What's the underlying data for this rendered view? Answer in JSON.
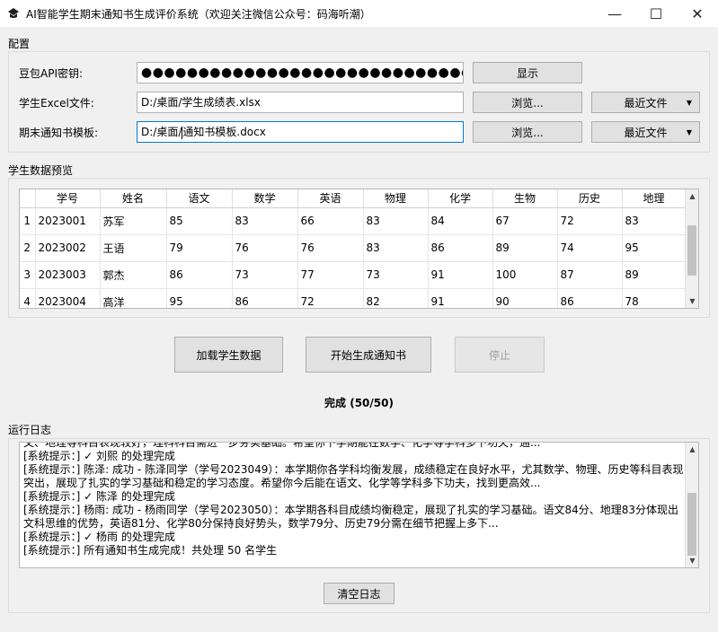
{
  "window": {
    "title": "AI智能学生期末通知书生成评价系统（欢迎关注微信公众号：码海听潮）",
    "minimize": "—",
    "maximize": "☐",
    "close": "✕"
  },
  "config": {
    "group_title": "配置",
    "api_key_label": "豆包API密钥:",
    "api_key_value": "●●●●●●●●●●●●●●●●●●●●●●●●●●●●●●●●●●●●",
    "show_button": "显示",
    "excel_label": "学生Excel文件:",
    "excel_value": "D:/桌面/学生成绩表.xlsx",
    "browse_button": "浏览...",
    "recent_button": "最近文件",
    "template_label": "期末通知书模板:",
    "template_value_before": "D:/桌面/",
    "template_value_after": "通知书模板.docx"
  },
  "preview": {
    "group_title": "学生数据预览",
    "columns": [
      "学号",
      "姓名",
      "语文",
      "数学",
      "英语",
      "物理",
      "化学",
      "生物",
      "历史",
      "地理"
    ],
    "rows": [
      {
        "num": "1",
        "cells": [
          "2023001",
          "苏军",
          "85",
          "83",
          "66",
          "83",
          "84",
          "67",
          "72",
          "83"
        ]
      },
      {
        "num": "2",
        "cells": [
          "2023002",
          "王语",
          "79",
          "76",
          "76",
          "83",
          "86",
          "89",
          "74",
          "95"
        ]
      },
      {
        "num": "3",
        "cells": [
          "2023003",
          "郭杰",
          "86",
          "73",
          "77",
          "73",
          "91",
          "100",
          "87",
          "89"
        ]
      },
      {
        "num": "4",
        "cells": [
          "2023004",
          "高洋",
          "95",
          "86",
          "72",
          "82",
          "91",
          "90",
          "86",
          "78"
        ]
      }
    ]
  },
  "actions": {
    "load_button": "加载学生数据",
    "start_button": "开始生成通知书",
    "stop_button": "停止",
    "status": "完成 (50/50)"
  },
  "log": {
    "group_title": "运行日志",
    "lines": [
      "文、地理等科目表现较好，理科科目需进一步夯实基础。希望你下学期能在数学、化学等学科多下功夫，通...",
      "[系统提示：] ✓ 刘熙 的处理完成",
      "[系统提示：] 陈泽: 成功 - 陈泽同学（学号2023049）：本学期你各学科均衡发展，成绩稳定在良好水平，尤其数学、物理、历史等科目表现突出，展现了扎实的学习基础和稳定的学习态度。希望你今后能在语文、化学等学科多下功夫，找到更高效...",
      "[系统提示：] ✓ 陈泽 的处理完成",
      "[系统提示：] 杨雨: 成功 - 杨雨同学（学号2023050）：本学期各科目成绩均衡稳定，展现了扎实的学习基础。语文84分、地理83分体现出文科思维的优势，英语81分、化学80分保持良好势头，数学79分、历史79分需在细节把握上多下...",
      "[系统提示：] ✓ 杨雨 的处理完成",
      "[系统提示：] 所有通知书生成完成！共处理 50 名学生"
    ],
    "clear_button": "清空日志"
  },
  "colors": {
    "focus_border": "#0078d7",
    "app_icon": "#1a1a1a"
  }
}
